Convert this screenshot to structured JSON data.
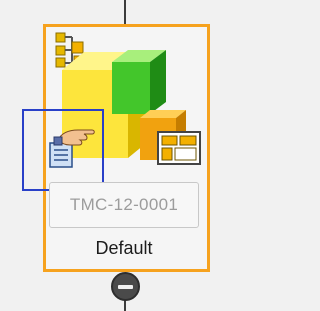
{
  "card": {
    "id_value": "TMC-12-0001",
    "name": "Default",
    "accent_color": "#f6a21e",
    "selection_color": "#2940c8"
  },
  "icons": {
    "main": "assembly-blocks-icon",
    "top_left": "hierarchy-tree-icon",
    "bottom_right": "layout-grid-icon",
    "overlay": "edit-document-hand-icon",
    "remove": "remove-minus-icon"
  }
}
